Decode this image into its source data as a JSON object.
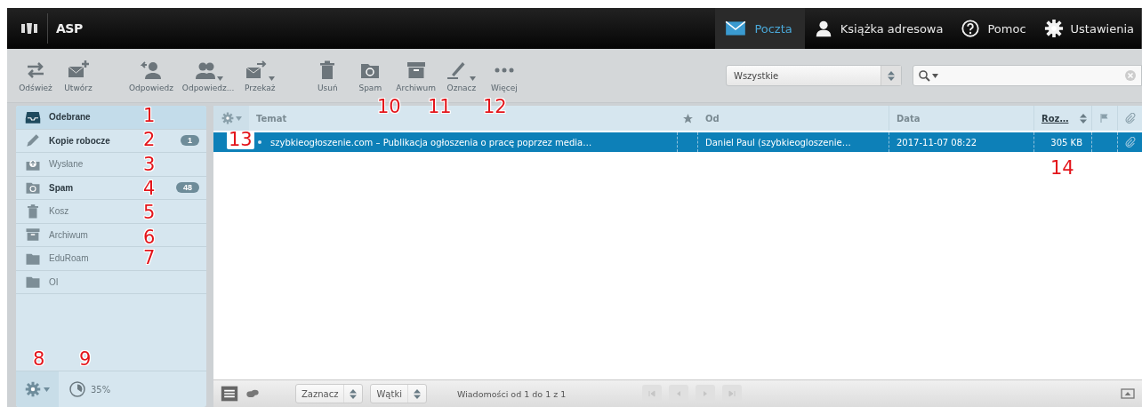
{
  "header": {
    "logo": "ASP",
    "tabs": [
      {
        "label": "Poczta",
        "kind": "mail",
        "selected": true
      },
      {
        "label": "Książka adresowa",
        "kind": "person",
        "selected": false
      },
      {
        "label": "Pomoc",
        "kind": "help",
        "selected": false
      },
      {
        "label": "Ustawienia",
        "kind": "gear",
        "selected": false
      }
    ]
  },
  "toolbar": {
    "buttons": [
      {
        "label": "Odśwież",
        "kind": "refresh",
        "menu": false
      },
      {
        "label": "Utwórz",
        "kind": "compose",
        "menu": false
      },
      {
        "label": "Odpowiedz",
        "kind": "reply",
        "menu": false
      },
      {
        "label": "Odpowiedz...",
        "kind": "reply-all",
        "menu": true
      },
      {
        "label": "Przekaż",
        "kind": "forward",
        "menu": true
      },
      {
        "label": "Usuń",
        "kind": "trash",
        "menu": false
      },
      {
        "label": "Spam",
        "kind": "spam",
        "menu": false
      },
      {
        "label": "Archiwum",
        "kind": "archive",
        "menu": false
      },
      {
        "label": "Oznacz",
        "kind": "mark",
        "menu": true
      },
      {
        "label": "Więcej",
        "kind": "more",
        "menu": false
      }
    ],
    "filter": "Wszystkie"
  },
  "folders": [
    {
      "name": "Odebrane",
      "kind": "inbox",
      "selected": true,
      "unread": true
    },
    {
      "name": "Kopie robocze",
      "kind": "draft",
      "selected": false,
      "unread": true,
      "count": "1"
    },
    {
      "name": "Wysłane",
      "kind": "sent",
      "selected": false,
      "unread": false
    },
    {
      "name": "Spam",
      "kind": "spam",
      "selected": false,
      "unread": true,
      "count": "48"
    },
    {
      "name": "Kosz",
      "kind": "trash",
      "selected": false,
      "unread": false
    },
    {
      "name": "Archiwum",
      "kind": "archive",
      "selected": false,
      "unread": false
    },
    {
      "name": "EduRoam",
      "kind": "folder",
      "selected": false,
      "unread": false
    },
    {
      "name": "OI",
      "kind": "folder",
      "selected": false,
      "unread": false
    }
  ],
  "quota": {
    "reading": "35%"
  },
  "messages": {
    "columns": [
      "Temat",
      "Od",
      "Data",
      "Roz…"
    ],
    "rows": [
      {
        "subject": "szybkieogłoszenie.com – Publikacja ogłoszenia o pracę poprzez media…",
        "from": "Daniel Paul (szybkieogloszenie…",
        "date": "2017-11-07 08:22",
        "size": "305 KB",
        "attachment": true,
        "selected": true
      }
    ]
  },
  "footer": {
    "select": "Zaznacz",
    "threads": "Wątki",
    "count": "Wiadomości od 1 do 1 z 1"
  },
  "annotations": [
    "1",
    "2",
    "3",
    "4",
    "5",
    "6",
    "7",
    "8",
    "9",
    "10",
    "11",
    "12",
    "13",
    "14"
  ]
}
